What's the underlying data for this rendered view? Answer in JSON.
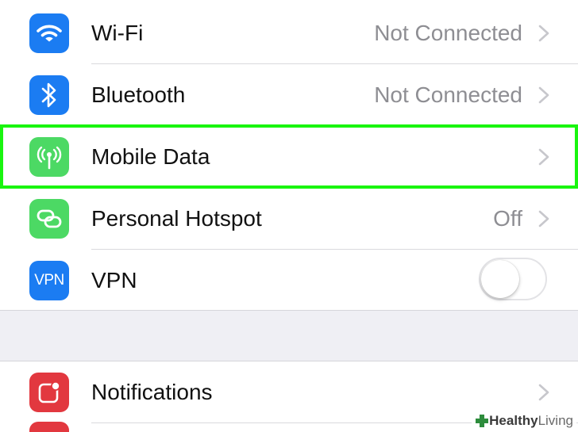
{
  "rows": [
    {
      "label": "Wi-Fi",
      "value": "Not Connected",
      "icon": "wifi-icon",
      "icon_color": "#1b7cf2"
    },
    {
      "label": "Bluetooth",
      "value": "Not Connected",
      "icon": "bluetooth-icon",
      "icon_color": "#1b7cf2"
    },
    {
      "label": "Mobile Data",
      "value": "",
      "icon": "antenna-icon",
      "icon_color": "#4cd964"
    },
    {
      "label": "Personal Hotspot",
      "value": "Off",
      "icon": "hotspot-icon",
      "icon_color": "#4cd964"
    },
    {
      "label": "VPN",
      "icon_text": "VPN",
      "icon": "vpn-icon",
      "icon_color": "#1b7cf2",
      "toggle_on": false
    },
    {
      "label": "Notifications",
      "value": "",
      "icon": "notifications-icon",
      "icon_color": "#e2383f"
    }
  ],
  "highlight_color": "#19f50f",
  "watermark": {
    "strong": "Healthy",
    "light": " Living"
  }
}
